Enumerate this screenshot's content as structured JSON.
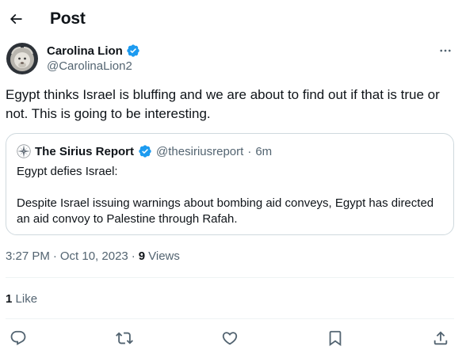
{
  "header": {
    "title": "Post",
    "back_icon": "arrow-left-icon"
  },
  "author": {
    "name": "Carolina Lion",
    "handle": "@CarolinaLion2",
    "verified_icon": "verified-badge-icon",
    "more_icon": "more-horizontal-icon"
  },
  "post": {
    "text": "Egypt thinks Israel is bluffing and we are about to find out if that is true or not. This is going to be interesting."
  },
  "quote": {
    "name": "The Sirius Report",
    "handle": "@thesiriusreport",
    "separator": "·",
    "time": "6m",
    "text": "Egypt defies Israel:\n\nDespite Israel issuing warnings about bombing aid conveys, Egypt has directed an aid convoy to Palestine through Rafah."
  },
  "meta": {
    "time": "3:27 PM",
    "separator": "·",
    "date": "Oct 10, 2023",
    "views_separator": "·",
    "views_count": "9",
    "views_label": "Views"
  },
  "engagement": {
    "likes_count": "1",
    "likes_label": "Like"
  },
  "actions": [
    "reply-icon",
    "repost-icon",
    "like-icon",
    "bookmark-icon",
    "share-icon"
  ],
  "colors": {
    "text": "#0f1419",
    "secondary": "#536471",
    "verified": "#1d9bf0",
    "border": "#cfd9de",
    "divider": "#eff3f4"
  }
}
